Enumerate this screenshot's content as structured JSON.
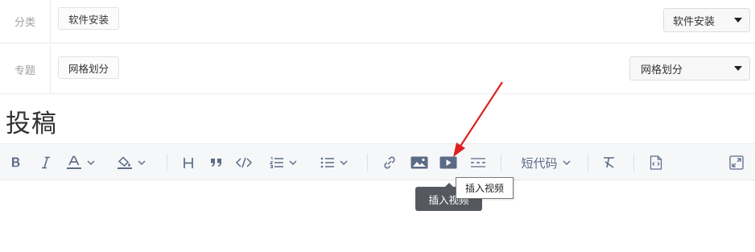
{
  "category": {
    "label": "分类",
    "tag": "软件安装",
    "select_value": "软件安装"
  },
  "topic": {
    "label": "专题",
    "tag": "网格划分",
    "select_value": "网格划分"
  },
  "post_title": "投稿",
  "toolbar": {
    "shortcode_label": "短代码",
    "items": [
      "bold",
      "italic",
      "font-color",
      "background-color",
      "heading",
      "quote",
      "code",
      "ordered-list",
      "bullet-list",
      "link",
      "image",
      "video",
      "divider",
      "shortcode",
      "clear-format",
      "source",
      "fullscreen"
    ]
  },
  "tooltips": {
    "dark": "插入视频",
    "light": "插入视频"
  },
  "colors": {
    "icon": "#5b6b86",
    "toolbar_bg": "#f6f7f9",
    "arrow": "#e02020",
    "tooltip_dark": "#55595f"
  }
}
